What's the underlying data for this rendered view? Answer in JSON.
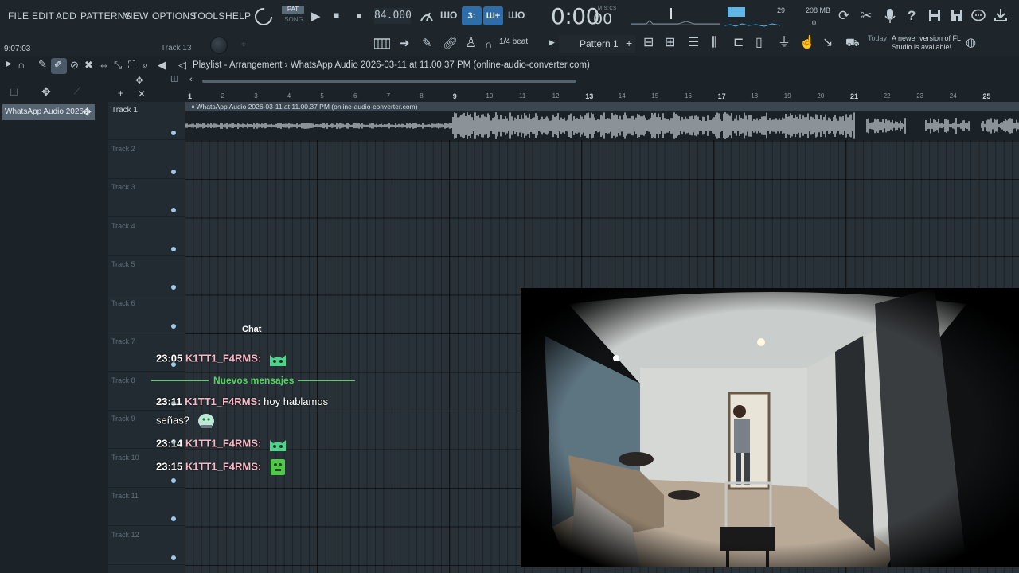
{
  "menu": [
    "FILE",
    "EDIT",
    "ADD",
    "PATTERNS",
    "VIEW",
    "OPTIONS",
    "TOOLS",
    "HELP"
  ],
  "transport": {
    "pat_label": "PAT",
    "song_label": "SONG",
    "tempo": "84.000",
    "time_main": "0:00",
    "time_frac": "00",
    "time_unit": "M:S:CS",
    "cpu_value": "29",
    "memory": "208 MB",
    "polyphony": "0"
  },
  "toolbar2": {
    "clock": "9:07:03",
    "track_hint": "Track 13",
    "snap": "1/4 beat",
    "pattern": "Pattern 1",
    "news_today": "Today",
    "news_text": "A newer version of FL Studio is available!"
  },
  "playlist": {
    "breadcrumb": "Playlist - Arrangement › WhatsApp Audio 2026-03-11 at 11.00.37 PM (online-audio-converter.com)",
    "picker_clip": "WhatsApp Audio 2026..",
    "clip_name": "WhatsApp Audio 2026-03-11 at 11.00.37 PM (online-audio-converter.com)",
    "ruler": [
      "1",
      "2",
      "3",
      "4",
      "5",
      "6",
      "7",
      "8",
      "9",
      "10",
      "11",
      "12",
      "13",
      "14",
      "15",
      "16",
      "17",
      "18",
      "19",
      "20",
      "21",
      "22",
      "23",
      "24",
      "25"
    ],
    "tracks": [
      "Track 1",
      "Track 2",
      "Track 3",
      "Track 4",
      "Track 5",
      "Track 6",
      "Track 7",
      "Track 8",
      "Track 9",
      "Track 10",
      "Track 11",
      "Track 12"
    ]
  },
  "chat": {
    "title": "Chat",
    "new_messages": "Nuevos mensajes",
    "messages": [
      {
        "time": "23:05",
        "user": "K1TT1_F4RMS:",
        "text": ""
      },
      {
        "time": "23:11",
        "user": "K1TT1_F4RMS:",
        "text": "hoy hablamos"
      },
      {
        "time": "",
        "user": "",
        "text": "señas?"
      },
      {
        "time": "23:14",
        "user": "K1TT1_F4RMS:",
        "text": ""
      },
      {
        "time": "23:15",
        "user": "K1TT1_F4RMS:",
        "text": ""
      }
    ]
  },
  "colors": {
    "accent": "#2f6da8",
    "chat_user": "#f6b8c6",
    "new_messages": "#52d35e",
    "waveform": "#c8d0d6",
    "background": "#1c2328"
  }
}
